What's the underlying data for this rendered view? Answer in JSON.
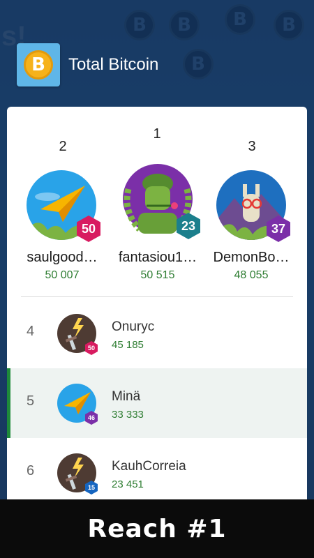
{
  "app": {
    "title": "Total Bitcoin",
    "icon": "bitcoin-icon",
    "coin_symbol": "B"
  },
  "background": {
    "text": "s!",
    "coin_symbol": "B"
  },
  "colors": {
    "accent_green": "#2e7d32",
    "highlight_bar": "#1e8a3a",
    "badge_red": "#d81b60",
    "badge_teal": "#1b7f8c",
    "badge_purple": "#7b2fa8",
    "badge_blue": "#1565c0"
  },
  "podium": [
    {
      "rank": "2",
      "name": "saulgood…",
      "score": "50 007",
      "level": "50",
      "avatar": "paper-plane-avatar"
    },
    {
      "rank": "1",
      "name": "fantasiou1…",
      "score": "50 515",
      "level": "23",
      "avatar": "soldier-avatar"
    },
    {
      "rank": "3",
      "name": "DemonBo…",
      "score": "48 055",
      "level": "37",
      "avatar": "llama-avatar"
    }
  ],
  "list": [
    {
      "rank": "4",
      "name": "Onuryc",
      "score": "45 185",
      "level": "50",
      "avatar": "sword-avatar"
    },
    {
      "rank": "5",
      "name": "Minä",
      "score": "33 333",
      "level": "46",
      "avatar": "paper-plane-avatar",
      "is_me": true
    },
    {
      "rank": "6",
      "name": "KauhCorreia",
      "score": "23 451",
      "level": "15",
      "avatar": "sword-avatar"
    }
  ],
  "footer": {
    "text": "Reach #1"
  }
}
